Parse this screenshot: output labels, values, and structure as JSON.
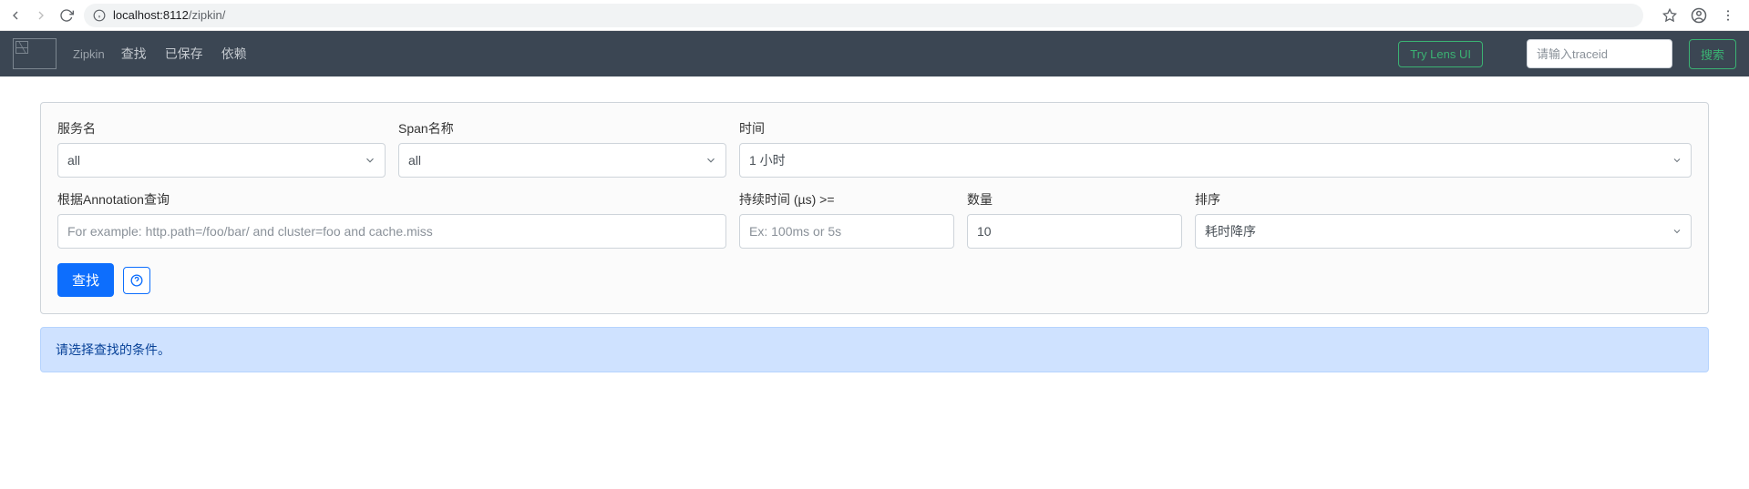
{
  "browser": {
    "url_host": "localhost:8112",
    "url_path": "/zipkin/"
  },
  "header": {
    "brand": "Zipkin",
    "nav": {
      "find": "查找",
      "saved": "已保存",
      "deps": "依赖"
    },
    "try_lens": "Try Lens UI",
    "traceid_placeholder": "请输入traceid",
    "search_btn": "搜索"
  },
  "form": {
    "labels": {
      "service": "服务名",
      "span": "Span名称",
      "time": "时间",
      "annotation": "根据Annotation查询",
      "duration": "持续时间 (µs) >=",
      "limit": "数量",
      "sort": "排序"
    },
    "values": {
      "service": "all",
      "span": "all",
      "time": "1 小时",
      "annotation": "",
      "duration": "",
      "limit": "10",
      "sort": "耗时降序"
    },
    "placeholders": {
      "annotation": "For example: http.path=/foo/bar/ and cluster=foo and cache.miss",
      "duration": "Ex: 100ms or 5s"
    },
    "find_btn": "查找"
  },
  "alert": {
    "message": "请选择查找的条件。"
  }
}
